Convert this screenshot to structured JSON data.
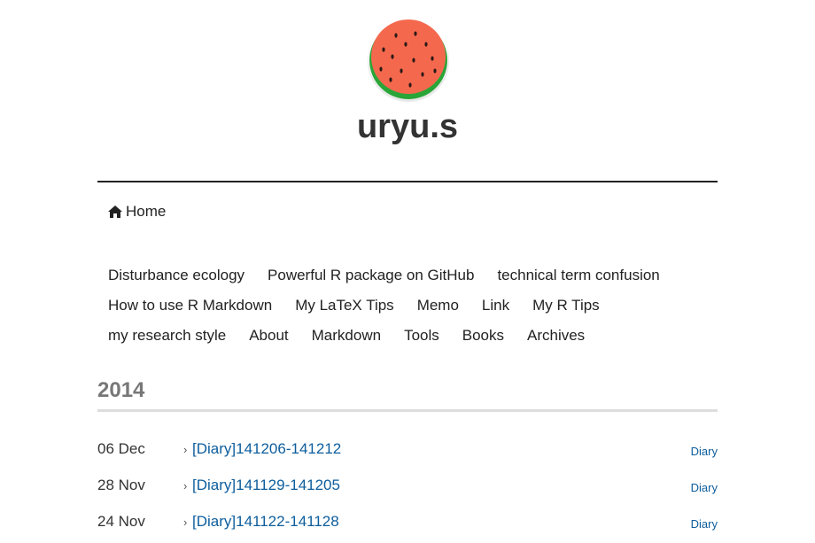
{
  "site": {
    "title": "uryu.s"
  },
  "nav": {
    "home_label": "Home",
    "rows": [
      [
        "Disturbance ecology",
        "Powerful R package on GitHub",
        "technical term confusion"
      ],
      [
        "How to use R Markdown",
        "My LaTeX Tips",
        "Memo",
        "Link",
        "My R Tips"
      ],
      [
        "my research style",
        "About",
        "Markdown",
        "Tools",
        "Books",
        "Archives"
      ]
    ]
  },
  "archive": {
    "year": "2014",
    "posts": [
      {
        "date": "06 Dec",
        "title": "[Diary]141206-141212",
        "category": "Diary"
      },
      {
        "date": "28 Nov",
        "title": "[Diary]141129-141205",
        "category": "Diary"
      },
      {
        "date": "24 Nov",
        "title": "[Diary]141122-141128",
        "category": "Diary"
      }
    ]
  },
  "colors": {
    "link": "#0d5d9c",
    "avatar_flesh": "#f4694e",
    "avatar_rind": "#2aa538"
  },
  "icons": {
    "avatar": "watermelon-avatar",
    "home": "home-icon"
  }
}
